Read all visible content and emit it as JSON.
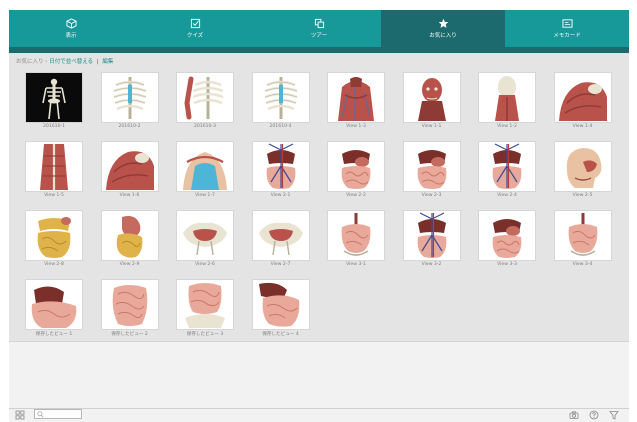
{
  "colors": {
    "tab_bg": "#17999a",
    "tab_active": "#1d6a6e",
    "link": "#1f8a8a"
  },
  "tabs": [
    {
      "label": "表示",
      "icon": "cube-icon"
    },
    {
      "label": "クイズ",
      "icon": "checkbox-icon"
    },
    {
      "label": "ツアー",
      "icon": "tour-icon"
    },
    {
      "label": "お気に入り",
      "icon": "star-icon",
      "active": true
    },
    {
      "label": "メモカード",
      "icon": "flashcard-icon"
    }
  ],
  "breadcrumb": {
    "root": "お気に入り",
    "separator": "›",
    "sort_link": "日付で並べ替える",
    "divider": "|",
    "edit_link": "編集"
  },
  "favorites": [
    {
      "label": "201610-1",
      "kind": "skeleton-dark"
    },
    {
      "label": "201610-2",
      "kind": "ribcage"
    },
    {
      "label": "201610-3",
      "kind": "ribcage-arm"
    },
    {
      "label": "201610-4",
      "kind": "ribcage"
    },
    {
      "label": "View 1-3",
      "kind": "torso-muscle"
    },
    {
      "label": "View 1-1",
      "kind": "head-muscle"
    },
    {
      "label": "View 1-2",
      "kind": "head-back"
    },
    {
      "label": "View 1-4",
      "kind": "shoulder"
    },
    {
      "label": "View 1-5",
      "kind": "back-muscle"
    },
    {
      "label": "View 1-6",
      "kind": "shoulder"
    },
    {
      "label": "View 1-7",
      "kind": "torso-blue"
    },
    {
      "label": "View 2-1",
      "kind": "organs-vessels"
    },
    {
      "label": "View 2-2",
      "kind": "organs"
    },
    {
      "label": "View 2-3",
      "kind": "organs"
    },
    {
      "label": "View 2-4",
      "kind": "organs-vessels"
    },
    {
      "label": "View 2-5",
      "kind": "head-side"
    },
    {
      "label": "View 2-8",
      "kind": "intestine-yellow"
    },
    {
      "label": "View 2-9",
      "kind": "stomach-yellow"
    },
    {
      "label": "View 2-6",
      "kind": "pelvis"
    },
    {
      "label": "View 2-7",
      "kind": "pelvis"
    },
    {
      "label": "View 3-1",
      "kind": "intestine-small"
    },
    {
      "label": "View 3-2",
      "kind": "organs-vessels"
    },
    {
      "label": "View 3-3",
      "kind": "organs"
    },
    {
      "label": "View 3-4",
      "kind": "intestine-small"
    },
    {
      "label": "保存したビュー 1",
      "kind": "liver-intestine"
    },
    {
      "label": "保存したビュー 2",
      "kind": "intestine"
    },
    {
      "label": "保存したビュー 3",
      "kind": "intestine-pelvis"
    },
    {
      "label": "保存したビュー 4",
      "kind": "intestine-liver"
    }
  ],
  "bottombar": {
    "search_placeholder": "",
    "icons": [
      "grid-icon",
      "search-icon",
      "camera-icon",
      "help-icon",
      "filter-icon"
    ]
  }
}
